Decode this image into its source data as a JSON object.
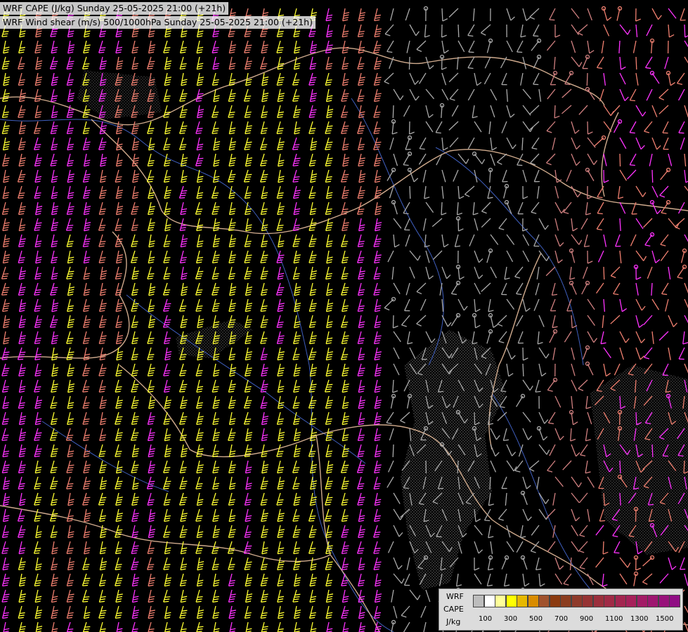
{
  "titles": {
    "line1": "WRF CAPE (J/kg) Sunday 25-05-2025 21:00 (+21h)",
    "line2": "WRF Wind shear (m/s) 500/1000hPa Sunday 25-05-2025 21:00 (+21h)"
  },
  "legend": {
    "model": "WRF",
    "field": "CAPE",
    "units": "J/kg",
    "colors": [
      "#bdbdbd",
      "#ffffff",
      "#ffff99",
      "#ffff00",
      "#e6b800",
      "#d98c00",
      "#a0522d",
      "#8b3a0f",
      "#8b3d1f",
      "#8e3a2a",
      "#963333",
      "#9b2f3c",
      "#a02a46",
      "#a32550",
      "#a6205a",
      "#a31b66",
      "#9e1670",
      "#98117a",
      "#900d84"
    ],
    "ticks": [
      "100",
      "300",
      "500",
      "700",
      "900",
      "1100",
      "1300",
      "1500"
    ]
  },
  "barb_colors": {
    "yellow": "#ffff33",
    "magenta": "#ff33ff",
    "salmon": "#f08070",
    "dusty_rose": "#d08080",
    "gray": "#aaaaaa"
  },
  "map_colors": {
    "border": "#e8c0a0",
    "river": "#4466cc",
    "hatch": "#888888"
  }
}
